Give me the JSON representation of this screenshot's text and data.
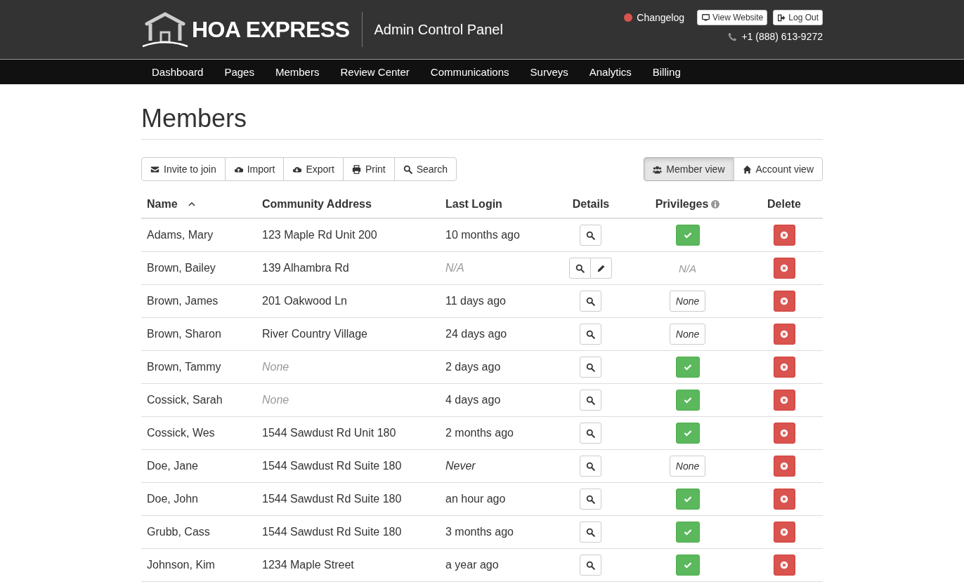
{
  "header": {
    "brand": "HOA EXPRESS",
    "subtitle": "Admin Control Panel",
    "changelog": {
      "label": "Changelog",
      "color": "#d9534f"
    },
    "buttons": [
      {
        "kind": "monitor",
        "label": "View Website"
      },
      {
        "kind": "logout",
        "label": "Log Out"
      }
    ],
    "phone": "+1 (888) 613-9272"
  },
  "nav": [
    {
      "label": "Dashboard"
    },
    {
      "label": "Pages"
    },
    {
      "label": "Members"
    },
    {
      "label": "Review Center"
    },
    {
      "label": "Communications"
    },
    {
      "label": "Surveys"
    },
    {
      "label": "Analytics"
    },
    {
      "label": "Billing"
    }
  ],
  "page_title": "Members",
  "toolbar": [
    {
      "kind": "envelope",
      "label": "Invite to join"
    },
    {
      "kind": "upload",
      "label": "Import"
    },
    {
      "kind": "download",
      "label": "Export"
    },
    {
      "kind": "print",
      "label": "Print"
    },
    {
      "kind": "search",
      "label": "Search"
    }
  ],
  "views": [
    {
      "kind": "users",
      "label": "Member view",
      "selected": true
    },
    {
      "kind": "home",
      "label": "Account view",
      "selected": false
    }
  ],
  "table": {
    "columns": [
      {
        "label": "Name",
        "sorted": true
      },
      {
        "label": "Community Address"
      },
      {
        "label": "Last Login"
      },
      {
        "label": "Details"
      },
      {
        "label": "Privileges",
        "info": true
      },
      {
        "label": "Delete"
      }
    ],
    "rows": [
      {
        "name": "Adams, Mary",
        "address": {
          "text": "123 Maple Rd Unit 200",
          "kind": "plain"
        },
        "last_login": {
          "text": "10 months ago",
          "kind": "plain"
        },
        "editable": false,
        "privileges": {
          "kind": "check"
        }
      },
      {
        "name": "Brown, Bailey",
        "address": {
          "text": "139 Alhambra Rd",
          "kind": "plain"
        },
        "last_login": {
          "text": "N/A",
          "kind": "muted"
        },
        "editable": true,
        "privileges": {
          "kind": "muted",
          "text": "N/A"
        }
      },
      {
        "name": "Brown, James",
        "address": {
          "text": "201 Oakwood Ln",
          "kind": "plain"
        },
        "last_login": {
          "text": "11 days ago",
          "kind": "plain"
        },
        "editable": false,
        "privileges": {
          "kind": "badge",
          "text": "None"
        }
      },
      {
        "name": "Brown, Sharon",
        "address": {
          "text": "River Country Village",
          "kind": "plain"
        },
        "last_login": {
          "text": "24 days ago",
          "kind": "plain"
        },
        "editable": false,
        "privileges": {
          "kind": "badge",
          "text": "None"
        }
      },
      {
        "name": "Brown, Tammy",
        "address": {
          "text": "None",
          "kind": "muted"
        },
        "last_login": {
          "text": "2 days ago",
          "kind": "plain"
        },
        "editable": false,
        "privileges": {
          "kind": "check"
        }
      },
      {
        "name": "Cossick, Sarah",
        "address": {
          "text": "None",
          "kind": "muted"
        },
        "last_login": {
          "text": "4 days ago",
          "kind": "plain"
        },
        "editable": false,
        "privileges": {
          "kind": "check"
        }
      },
      {
        "name": "Cossick, Wes",
        "address": {
          "text": "1544 Sawdust Rd Unit 180",
          "kind": "plain"
        },
        "last_login": {
          "text": "2 months ago",
          "kind": "plain"
        },
        "editable": false,
        "privileges": {
          "kind": "check"
        }
      },
      {
        "name": "Doe, Jane",
        "address": {
          "text": "1544 Sawdust Rd Suite 180",
          "kind": "plain"
        },
        "last_login": {
          "text": "Never",
          "kind": "italic"
        },
        "editable": false,
        "privileges": {
          "kind": "badge",
          "text": "None"
        }
      },
      {
        "name": "Doe, John",
        "address": {
          "text": "1544 Sawdust Rd Suite 180",
          "kind": "plain"
        },
        "last_login": {
          "text": "an hour ago",
          "kind": "plain"
        },
        "editable": false,
        "privileges": {
          "kind": "check"
        }
      },
      {
        "name": "Grubb, Cass",
        "address": {
          "text": "1544 Sawdust Rd Suite 180",
          "kind": "plain"
        },
        "last_login": {
          "text": "3 months ago",
          "kind": "plain"
        },
        "editable": false,
        "privileges": {
          "kind": "check"
        }
      },
      {
        "name": "Johnson, Kim",
        "address": {
          "text": "1234 Maple Street",
          "kind": "plain"
        },
        "last_login": {
          "text": "a year ago",
          "kind": "plain"
        },
        "editable": false,
        "privileges": {
          "kind": "check"
        }
      }
    ]
  }
}
